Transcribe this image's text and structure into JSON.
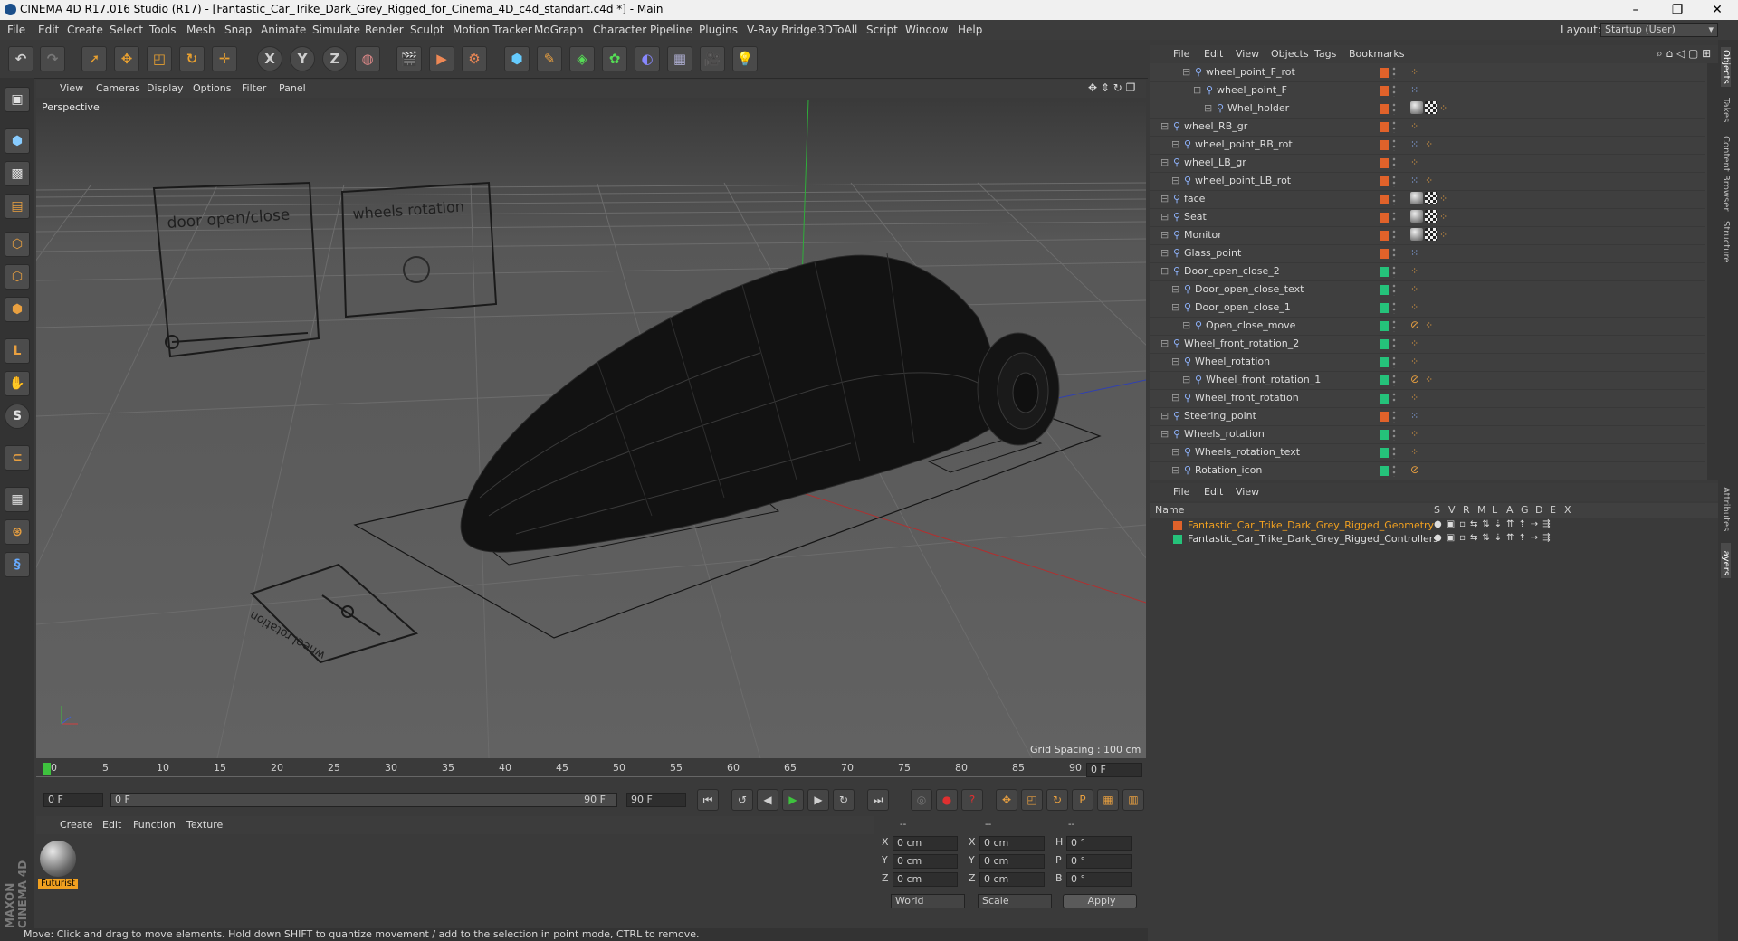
{
  "window": {
    "title": "CINEMA 4D R17.016 Studio (R17) - [Fantastic_Car_Trike_Dark_Grey_Rigged_for_Cinema_4D_c4d_standart.c4d *] - Main",
    "min": "–",
    "max": "❐",
    "close": "✕"
  },
  "menu": [
    "File",
    "Edit",
    "Create",
    "Select",
    "Tools",
    "Mesh",
    "Snap",
    "Animate",
    "Simulate",
    "Render",
    "Sculpt",
    "Motion Tracker",
    "MoGraph",
    "Character",
    "Pipeline",
    "Plugins",
    "V-Ray Bridge",
    "3DToAll",
    "Script",
    "Window",
    "Help"
  ],
  "layout": {
    "label": "Layout:",
    "value": "Startup (User)"
  },
  "toolbar": {
    "x": "X",
    "y": "Y",
    "z": "Z"
  },
  "viewport": {
    "menu": [
      "View",
      "Cameras",
      "Display",
      "Options",
      "Filter",
      "Panel"
    ],
    "label": "Perspective",
    "grid_spacing": "Grid Spacing : 100 cm",
    "sign_door": "door open/close",
    "sign_wheels": "wheels rotation",
    "sign_wheel": "wheel rotation"
  },
  "timeline": {
    "ticks": [
      "0",
      "5",
      "10",
      "15",
      "20",
      "25",
      "30",
      "35",
      "40",
      "45",
      "50",
      "55",
      "60",
      "65",
      "70",
      "75",
      "80",
      "85",
      "90"
    ],
    "end_frame": "0 F",
    "start_field": "0 F",
    "range_start": "0 F",
    "range_end": "90 F",
    "max_field": "90 F"
  },
  "material": {
    "menu": [
      "Create",
      "Edit",
      "Function",
      "Texture"
    ],
    "items": [
      {
        "name": "Futurist"
      }
    ]
  },
  "coords": {
    "headers": [
      "--",
      "--",
      "--"
    ],
    "rows": [
      {
        "a": "X",
        "av": "0 cm",
        "b": "X",
        "bv": "0 cm",
        "c": "H",
        "cv": "0 °"
      },
      {
        "a": "Y",
        "av": "0 cm",
        "b": "Y",
        "bv": "0 cm",
        "c": "P",
        "cv": "0 °"
      },
      {
        "a": "Z",
        "av": "0 cm",
        "b": "Z",
        "bv": "0 cm",
        "c": "B",
        "cv": "0 °"
      }
    ],
    "world": "World",
    "scale": "Scale",
    "apply": "Apply"
  },
  "status": "Move: Click and drag to move elements. Hold down SHIFT to quantize movement / add to the selection in point mode, CTRL to remove.",
  "objects": {
    "menu": [
      "File",
      "Edit",
      "View",
      "Objects",
      "Tags",
      "Bookmarks"
    ],
    "rows": [
      {
        "name": "wheel_point_F_rot",
        "indent": 3,
        "color": "#e0622a",
        "tags": [
          "orange"
        ]
      },
      {
        "name": "wheel_point_F",
        "indent": 4,
        "color": "#e0622a",
        "tags": [
          "blue"
        ]
      },
      {
        "name": "Whel_holder",
        "indent": 5,
        "color": "#e0622a",
        "tags": [
          "sphere",
          "checker",
          "orange"
        ]
      },
      {
        "name": "wheel_RB_gr",
        "indent": 1,
        "color": "#e0622a",
        "tags": [
          "orange"
        ]
      },
      {
        "name": "wheel_point_RB_rot",
        "indent": 2,
        "color": "#e0622a",
        "tags": [
          "blue",
          "orange"
        ]
      },
      {
        "name": "wheel_LB_gr",
        "indent": 1,
        "color": "#e0622a",
        "tags": [
          "orange"
        ]
      },
      {
        "name": "wheel_point_LB_rot",
        "indent": 2,
        "color": "#e0622a",
        "tags": [
          "blue",
          "orange"
        ]
      },
      {
        "name": "face",
        "indent": 1,
        "color": "#e0622a",
        "tags": [
          "sphere",
          "checker",
          "orange"
        ]
      },
      {
        "name": "Seat",
        "indent": 1,
        "color": "#e0622a",
        "tags": [
          "sphere",
          "checker",
          "orange"
        ]
      },
      {
        "name": "Monitor",
        "indent": 1,
        "color": "#e0622a",
        "tags": [
          "sphere",
          "checker",
          "orange"
        ]
      },
      {
        "name": "Glass_point",
        "indent": 1,
        "color": "#e0622a",
        "tags": [
          "blue"
        ]
      },
      {
        "name": "Door_open_close_2",
        "indent": 1,
        "color": "#25c27a",
        "tags": [
          "orange"
        ]
      },
      {
        "name": "Door_open_close_text",
        "indent": 2,
        "color": "#25c27a",
        "tags": [
          "orange"
        ]
      },
      {
        "name": "Door_open_close_1",
        "indent": 2,
        "color": "#25c27a",
        "tags": [
          "orange"
        ]
      },
      {
        "name": "Open_close_move",
        "indent": 3,
        "color": "#25c27a",
        "tags": [
          "forbid",
          "orange"
        ]
      },
      {
        "name": "Wheel_front_rotation_2",
        "indent": 1,
        "color": "#25c27a",
        "tags": [
          "orange"
        ]
      },
      {
        "name": "Wheel_rotation",
        "indent": 2,
        "color": "#25c27a",
        "tags": [
          "orange"
        ]
      },
      {
        "name": "Wheel_front_rotation_1",
        "indent": 3,
        "color": "#25c27a",
        "tags": [
          "forbid",
          "orange"
        ]
      },
      {
        "name": "Wheel_front_rotation",
        "indent": 2,
        "color": "#25c27a",
        "tags": [
          "orange"
        ]
      },
      {
        "name": "Steering_point",
        "indent": 1,
        "color": "#e0622a",
        "tags": [
          "blue"
        ]
      },
      {
        "name": "Wheels_rotation",
        "indent": 1,
        "color": "#25c27a",
        "tags": [
          "orange"
        ]
      },
      {
        "name": "Wheels_rotation_text",
        "indent": 2,
        "color": "#25c27a",
        "tags": [
          "orange"
        ]
      },
      {
        "name": "Rotation_icon",
        "indent": 2,
        "color": "#25c27a",
        "tags": [
          "forbid"
        ]
      }
    ]
  },
  "layers": {
    "menu": [
      "File",
      "Edit",
      "View"
    ],
    "headers": {
      "name": "Name",
      "cols": [
        "S",
        "V",
        "R",
        "M",
        "L",
        "A",
        "G",
        "D",
        "E",
        "X"
      ]
    },
    "rows": [
      {
        "name": "Fantastic_Car_Trike_Dark_Grey_Rigged_Geometry",
        "color": "#e0622a",
        "text_color": "#f0a020"
      },
      {
        "name": "Fantastic_Car_Trike_Dark_Grey_Rigged_Controllers",
        "color": "#25c27a",
        "text_color": "#dcdcdc"
      }
    ]
  },
  "side_tabs": [
    "Objects",
    "Takes",
    "Content Browser",
    "Structure",
    "Attributes",
    "Layers"
  ],
  "brand": "MAXON CINEMA 4D"
}
